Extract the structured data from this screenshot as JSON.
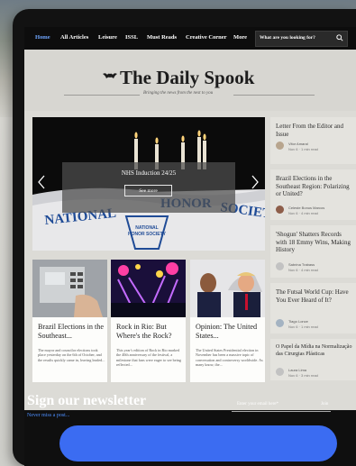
{
  "nav": {
    "items": [
      {
        "label": "Home",
        "active": true
      },
      {
        "label": "All Articles"
      },
      {
        "label": "Leisure"
      },
      {
        "label": "ISSL"
      },
      {
        "label": "Must Reads"
      },
      {
        "label": "Creative Corner"
      },
      {
        "label": "More"
      }
    ],
    "search_placeholder": "What are you looking for?"
  },
  "header": {
    "title": "The Daily Spook",
    "tagline": "Bringing the news from the nest to you"
  },
  "hero": {
    "title": "NHS Induction 24/25",
    "button_label": "See more"
  },
  "sidebar": {
    "items": [
      {
        "title": "Letter From the Editor and Issue",
        "author": "Vitor Amaral",
        "meta": "Nov 6 · 1 min read"
      },
      {
        "title": "Brazil Elections in the Southeast Region: Polarizing or United?",
        "author": "Celeste Bonus Marcos",
        "meta": "Nov 6 · 4 min read"
      },
      {
        "title": "'Shogun' Shatters Records with 18 Emmy Wins, Making History",
        "author": "Sabrina Trabass",
        "meta": "Nov 6 · 4 min read"
      },
      {
        "title": "The Futsal World Cup: Have You Ever Heard of It?",
        "author": "Tiago Lonce",
        "meta": "Nov 6 · 1 min read"
      },
      {
        "title": "O Papel da Mídia na Normalização das Cirurgias Plásticas",
        "author": "Laura Lima",
        "meta": "Nov 6 · 3 min read"
      }
    ]
  },
  "cards": [
    {
      "title": "Brazil Elections in the Southeast...",
      "body": "The mayor and councilor elections took place yesterday on the 6th of October, and the results quickly came in, leaving leaded..."
    },
    {
      "title": "Rock in Rio: But Where's the Rock?",
      "body": "This year's edition of Rock in Rio marked the 40th anniversary of the festival, a milestone that fans were eager to see being reflected..."
    },
    {
      "title": "Opinion: The United States...",
      "body": "The United States Presidential election in November has been a massive topic of conversation and controversy worldwide. As many know, the..."
    }
  ],
  "newsletter": {
    "title": "Sign our newsletter",
    "subtitle": "Never miss a post...",
    "email_label": "Enter your email here*",
    "join_label": "Join"
  },
  "colors": {
    "accent": "#3b6cf2",
    "active_nav": "#6fa6ff",
    "nav_bg": "#0d0d0d"
  }
}
